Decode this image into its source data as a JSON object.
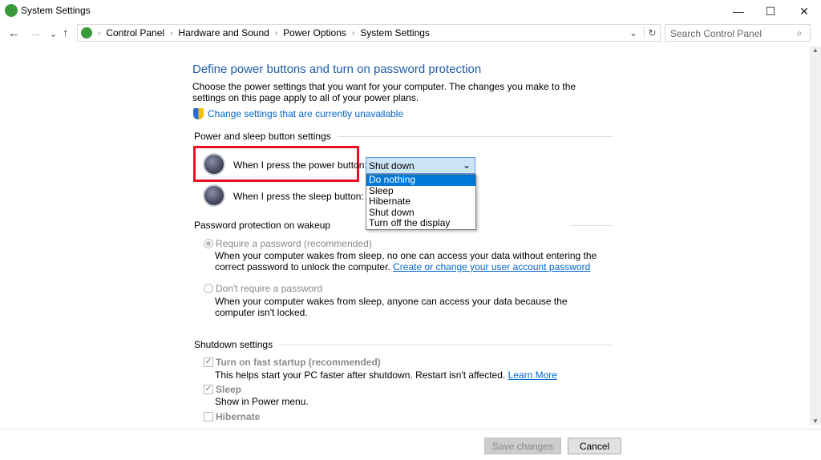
{
  "window": {
    "title": "System Settings",
    "app_icon": "power-options-icon",
    "minimize": "—",
    "maximize": "☐",
    "close": "✕"
  },
  "nav": {
    "back": "←",
    "forward": "→",
    "recent": "⌄",
    "up": "↑"
  },
  "breadcrumb": [
    "Control Panel",
    "Hardware and Sound",
    "Power Options",
    "System Settings"
  ],
  "search": {
    "placeholder": "Search Control Panel"
  },
  "page": {
    "title": "Define power buttons and turn on password protection",
    "description": "Choose the power settings that you want for your computer. The changes you make to the settings on this page apply to all of your power plans.",
    "change_link": "Change settings that are currently unavailable",
    "power_section": "Power and sleep button settings",
    "power_button_label": "When I press the power button:",
    "power_button_value": "Shut down",
    "sleep_button_label": "When I press the sleep button:",
    "dropdown_options": [
      "Do nothing",
      "Sleep",
      "Hibernate",
      "Shut down",
      "Turn off the display"
    ],
    "dropdown_highlighted": "Do nothing",
    "password_section": "Password protection on wakeup",
    "require_password": {
      "label": "Require a password (recommended)",
      "selected": true,
      "desc": "When your computer wakes from sleep, no one can access your data without entering the correct password to unlock the computer.",
      "link": "Create or change your user account password"
    },
    "no_password": {
      "label": "Don't require a password",
      "selected": false,
      "desc": "When your computer wakes from sleep, anyone can access your data because the computer isn't locked."
    },
    "shutdown_section": "Shutdown settings",
    "fast_startup": {
      "label": "Turn on fast startup (recommended)",
      "checked": true,
      "desc": "This helps start your PC faster after shutdown. Restart isn't affected.",
      "link": "Learn More"
    },
    "sleep": {
      "label": "Sleep",
      "checked": true,
      "desc": "Show in Power menu."
    },
    "hibernate": {
      "label": "Hibernate",
      "checked": false
    }
  },
  "footer": {
    "save": "Save changes",
    "cancel": "Cancel"
  },
  "colors": {
    "accent": "#0078d7",
    "highlight_box": "#e81123",
    "title": "#1e5aa8"
  }
}
